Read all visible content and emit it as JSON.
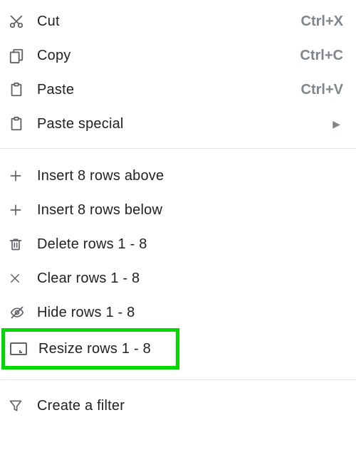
{
  "clipboard": {
    "cut": {
      "label": "Cut",
      "shortcut": "Ctrl+X"
    },
    "copy": {
      "label": "Copy",
      "shortcut": "Ctrl+C"
    },
    "paste": {
      "label": "Paste",
      "shortcut": "Ctrl+V"
    },
    "paste_special": {
      "label": "Paste special"
    }
  },
  "rows": {
    "insert_above": {
      "label": "Insert 8 rows above"
    },
    "insert_below": {
      "label": "Insert 8 rows below"
    },
    "delete": {
      "label": "Delete rows 1 - 8"
    },
    "clear": {
      "label": "Clear rows 1 - 8"
    },
    "hide": {
      "label": "Hide rows 1 - 8"
    },
    "resize": {
      "label": "Resize rows 1 - 8"
    }
  },
  "filter": {
    "create": {
      "label": "Create a filter"
    }
  }
}
